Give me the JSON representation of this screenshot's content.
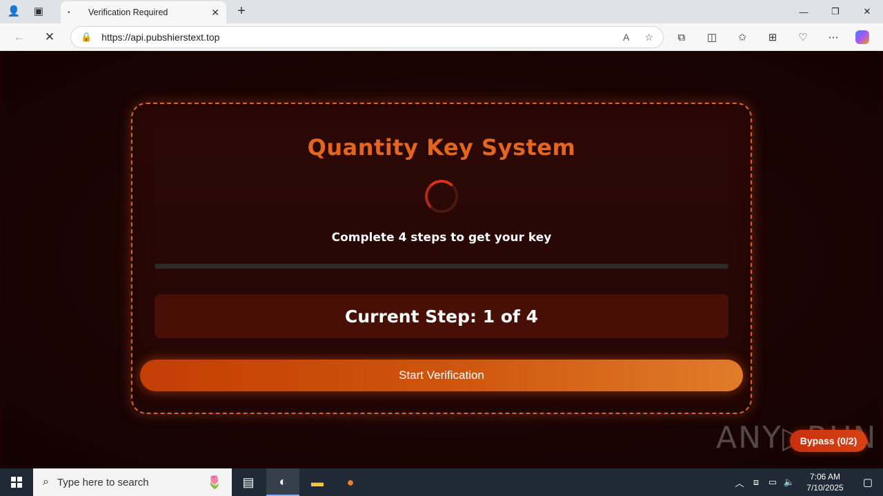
{
  "browser": {
    "tab_title": "Verification Required",
    "tab_favicon": "•",
    "url": "https://api.pubshierstext.top"
  },
  "page": {
    "title": "Quantity Key System",
    "subtitle": "Complete 4 steps to get your key",
    "progress_percent": 0,
    "current_step_text": "Current Step: 1 of 4",
    "start_button_label": "Start Verification",
    "bypass_button_label": "Bypass (0/2)",
    "accent_color": "#e2661f"
  },
  "watermark": {
    "text": "ANY▷RUN"
  },
  "taskbar": {
    "search_placeholder": "Type here to search",
    "time": "7:06 AM",
    "date": "7/10/2025"
  }
}
